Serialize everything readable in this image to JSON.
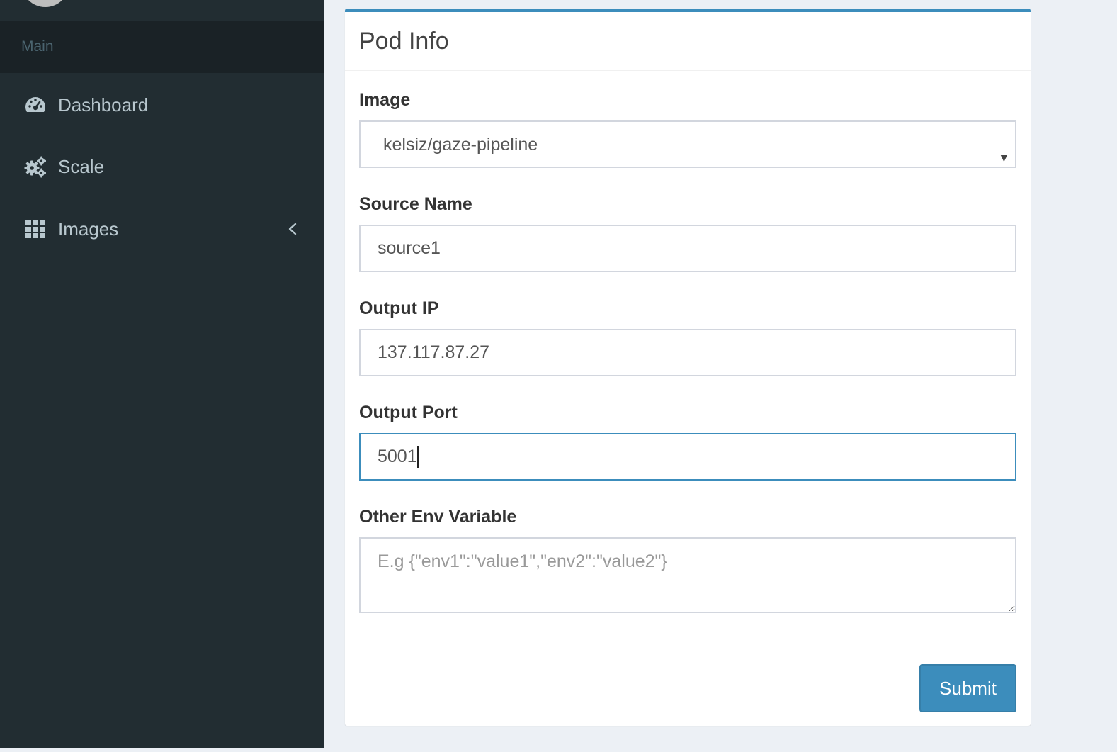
{
  "sidebar": {
    "header": "Main",
    "items": [
      {
        "label": "Dashboard",
        "icon": "dashboard-icon"
      },
      {
        "label": "Scale",
        "icon": "gears-icon"
      },
      {
        "label": "Images",
        "icon": "grid-icon",
        "expandable": true
      }
    ]
  },
  "form": {
    "title": "Pod Info",
    "image": {
      "label": "Image",
      "value": "kelsiz/gaze-pipeline"
    },
    "source_name": {
      "label": "Source Name",
      "value": "source1"
    },
    "output_ip": {
      "label": "Output IP",
      "value": "137.117.87.27"
    },
    "output_port": {
      "label": "Output Port",
      "value": "5001"
    },
    "env": {
      "label": "Other Env Variable",
      "placeholder": "E.g {\"env1\":\"value1\",\"env2\":\"value2\"}"
    },
    "submit_label": "Submit"
  },
  "colors": {
    "sidebar_bg": "#222d32",
    "accent": "#3c8dbc",
    "page_bg": "#ecf0f5"
  }
}
